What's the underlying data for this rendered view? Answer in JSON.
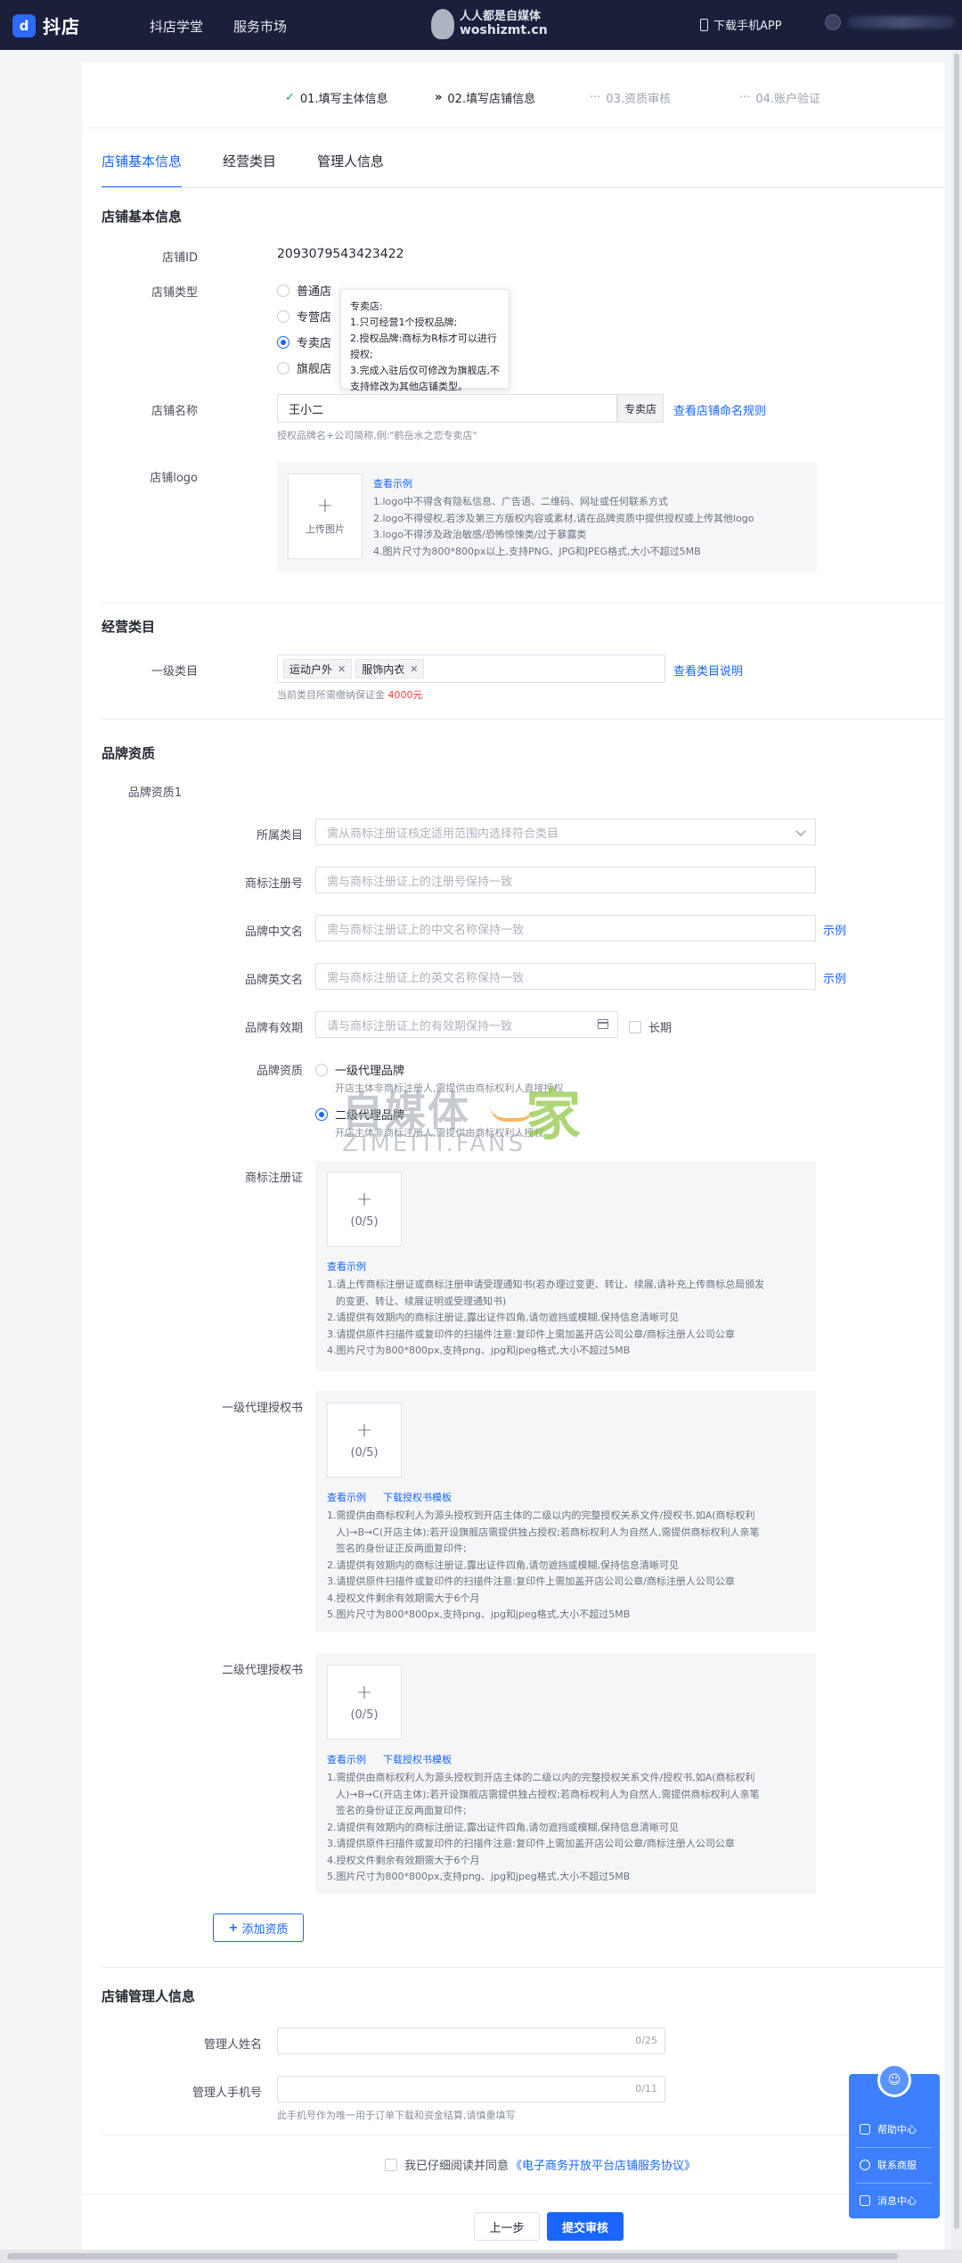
{
  "topbar": {
    "brand": "抖店",
    "nav": [
      "抖店学堂",
      "服务市场"
    ],
    "watermark_line1": "人人都是自媒体",
    "watermark_line2": "woshizmt.cn",
    "download": "下载手机APP",
    "user_tail": "234"
  },
  "steps": [
    {
      "mark": "✓",
      "label": "01.填写主体信息"
    },
    {
      "mark": "»",
      "label": "02.填写店铺信息"
    },
    {
      "mark": "···",
      "label": "03.资质审核"
    },
    {
      "mark": "···",
      "label": "04.账户验证"
    }
  ],
  "tabs": [
    "店铺基本信息",
    "经营类目",
    "管理人信息"
  ],
  "basic": {
    "section_title": "店铺基本信息",
    "shop_id_label": "店铺ID",
    "shop_id": "2093079543423422",
    "type_label": "店铺类型",
    "types": [
      "普通店",
      "专营店",
      "专卖店",
      "旗舰店"
    ],
    "tooltip_lines": [
      "专卖店:",
      "1.只可经营1个授权品牌;",
      "2.授权品牌:商标为R标才可以进行授权;",
      "3.完成入驻后仅可修改为旗舰店,不支持修改为其他店铺类型。"
    ],
    "name_label": "店铺名称",
    "name_value": "王小二",
    "name_suffix": "专卖店",
    "name_rule_link": "查看店铺命名规则",
    "name_hint": "授权品牌名+公司简称,例:\"鹤岳水之恋专卖店\"",
    "logo_label": "店铺logo",
    "logo_upload": "上传图片",
    "logo_example": "查看示例",
    "logo_rules": [
      "1.logo中不得含有隐私信息、广告语、二维码、网址或任何联系方式",
      "2.logo不得侵权,若涉及第三方版权内容或素材,请在品牌资质中提供授权或上传其他logo",
      "3.logo不得涉及政治敏感/恐怖惊悚类/过于暴露类",
      "4.图片尺寸为800*800px以上,支持PNG、JPG和JPEG格式,大小不超过5MB"
    ]
  },
  "category": {
    "section_title": "经营类目",
    "label": "一级类目",
    "tags": [
      "运动户外",
      "服饰内衣"
    ],
    "link": "查看类目说明",
    "deposit_prefix": "当前类目所需缴纳保证金",
    "deposit_amount": "4000元"
  },
  "brand": {
    "section_title": "品牌资质",
    "sub_title": "品牌资质1",
    "category_label": "所属类目",
    "category_ph": "需从商标注册证核定适用范围内选择符合类目",
    "reg_no_label": "商标注册号",
    "reg_no_ph": "需与商标注册证上的注册号保持一致",
    "cn_name_label": "品牌中文名",
    "cn_name_ph": "需与商标注册证上的中文名称保持一致",
    "en_name_label": "品牌英文名",
    "en_name_ph": "需与商标注册证上的英文名称保持一致",
    "example_link": "示例",
    "validity_label": "品牌有效期",
    "validity_ph": "请与商标注册证上的有效期保持一致",
    "longterm": "长期",
    "qual_label": "品牌资质",
    "qual_options": [
      {
        "title": "一级代理品牌",
        "desc": "开店主体非商标注册人,需提供由商标权利人直接授权"
      },
      {
        "title": "二级代理品牌",
        "desc": "开店主体非商标注册人,需提供由商标权利人授权"
      }
    ],
    "trademark_label": "商标注册证",
    "trademark_count": "(0/5)",
    "trademark_example": "查看示例",
    "trademark_rules": [
      "1.请上传商标注册证或商标注册申请受理通知书(若办理过变更、转让、续展,请补充上传商标总局颁发",
      "的变更、转让、续展证明或受理通知书)",
      "2.请提供有效期内的商标注册证,露出证件四角,请勿遮挡或模糊,保持信息清晰可见",
      "3.请提供原件扫描件或复印件的扫描件注意:复印件上需加盖开店公司公章/商标注册人公司公章",
      "4.图片尺寸为800*800px,支持png、jpg和jpeg格式,大小不超过5MB"
    ],
    "auth1_label": "一级代理授权书",
    "auth1_count": "(0/5)",
    "auth_example": "查看示例",
    "auth_template": "下载授权书模板",
    "auth1_rules": [
      "1.需提供由商标权利人为源头授权到开店主体的二级以内的完整授权关系文件/授权书,如A(商标权利",
      "人)→B→C(开店主体);若开设旗舰店需提供独占授权;若商标权利人为自然人,需提供商标权利人亲笔",
      "签名的身份证正反两面复印件;",
      "2.请提供有效期内的商标注册证,露出证件四角,请勿遮挡或模糊,保持信息清晰可见",
      "3.请提供原件扫描件或复印件的扫描件注意:复印件上需加盖开店公司公章/商标注册人公司公章",
      "4.授权文件剩余有效期需大于6个月",
      "5.图片尺寸为800*800px,支持png、jpg和jpeg格式,大小不超过5MB"
    ],
    "auth2_label": "二级代理授权书",
    "auth2_count": "(0/5)",
    "add_button": "添加资质"
  },
  "manager": {
    "section_title": "店铺管理人信息",
    "name_label": "管理人姓名",
    "name_counter": "0/25",
    "phone_label": "管理人手机号",
    "phone_counter": "0/11",
    "phone_hint": "此手机号作为唯一用于订单下载和资金结算,请慎重填写"
  },
  "agreement": {
    "prefix": "我已仔细阅读并同意",
    "link": "《电子商务开放平台店铺服务协议》"
  },
  "buttons": {
    "prev": "上一步",
    "submit": "提交审核"
  },
  "float_panel": [
    "帮助中心",
    "联系商服",
    "消息中心"
  ],
  "watermark_big": {
    "cn": "自媒体",
    "jia": "家",
    "en": "ZIMEITI.FANS"
  }
}
